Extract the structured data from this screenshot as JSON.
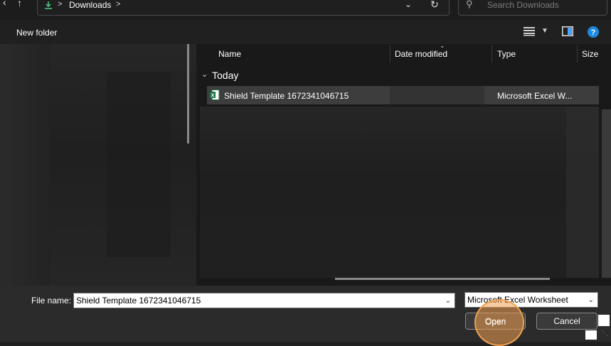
{
  "address": {
    "location": "Downloads",
    "separator_before": ">",
    "separator_after": ">"
  },
  "search": {
    "placeholder": "Search Downloads"
  },
  "command_bar": {
    "new_folder_label": "New folder"
  },
  "list": {
    "columns": {
      "name": "Name",
      "date_modified": "Date modified",
      "type": "Type",
      "size": "Size"
    },
    "group_label": "Today",
    "rows": [
      {
        "name": "Shield Template 1672341046715",
        "type": "Microsoft Excel W..."
      }
    ]
  },
  "footer": {
    "file_name_label": "File name:",
    "file_name_value": "Shield Template 1672341046715",
    "file_type_value": "Microsoft Excel Worksheet",
    "open_label": "Open",
    "cancel_label": "Cancel"
  },
  "colors": {
    "background": "#202020",
    "download_icon": "#4cc27a",
    "excel_icon": "#1e7145",
    "help_icon": "#1e88e5",
    "click_highlight": "#f0a050"
  },
  "icons": {
    "back": "chevron-left-icon",
    "up": "arrow-up-icon",
    "download": "download-icon",
    "dropdown": "chevron-down-icon",
    "refresh": "refresh-icon",
    "search": "search-icon",
    "view": "view-list-icon",
    "preview": "preview-pane-icon",
    "help": "help-icon",
    "excel": "excel-file-icon"
  }
}
